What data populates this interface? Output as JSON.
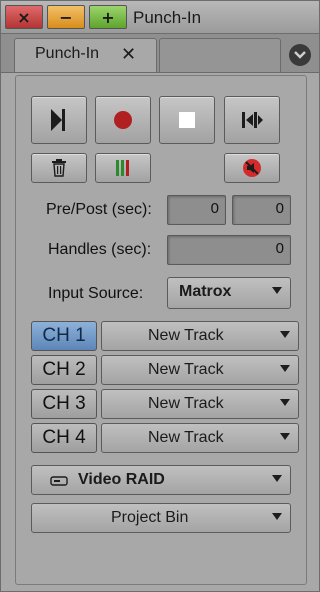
{
  "window": {
    "title": "Punch-In",
    "close_glyph": "×",
    "min_glyph": "−",
    "max_glyph": "+"
  },
  "tab": {
    "label": "Punch-In",
    "close_glyph": "✕",
    "menu_icon": "down-arrow-circle-icon"
  },
  "transport": {
    "icons": [
      "play-to-end-icon",
      "record-icon",
      "stop-icon",
      "jump-to-end-icon"
    ],
    "trash_icon": "trash-icon",
    "meter_icon": "audio-meter-icon",
    "mute_icon": "no-sound-icon"
  },
  "prepost": {
    "label": "Pre/Post (sec):",
    "pre_value": "0",
    "post_value": "0"
  },
  "handles": {
    "label": "Handles (sec):",
    "value": "0"
  },
  "input_source": {
    "label": "Input Source:",
    "value": "Matrox"
  },
  "channels": [
    {
      "label": "CH 1",
      "track": "New Track",
      "active": true
    },
    {
      "label": "CH 2",
      "track": "New Track",
      "active": false
    },
    {
      "label": "CH 3",
      "track": "New Track",
      "active": false
    },
    {
      "label": "CH 4",
      "track": "New Track",
      "active": false
    }
  ],
  "storage": {
    "value": "Video RAID",
    "icon": "drive-icon"
  },
  "bin": {
    "value": "Project Bin"
  },
  "colors": {
    "record": "#b02020",
    "close_button": "#c84848",
    "min_button": "#e8a43a",
    "max_button": "#78bc48",
    "channel_active": "#6f97c6"
  }
}
